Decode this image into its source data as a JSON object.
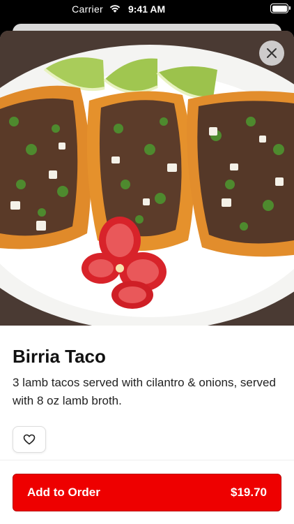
{
  "status_bar": {
    "carrier": "Carrier",
    "time": "9:41 AM"
  },
  "item": {
    "name": "Birria Taco",
    "description": "3 lamb tacos served with cilantro & onions, served with 8 oz lamb broth.",
    "image": "birria-tacos-photo"
  },
  "actions": {
    "add_to_order_label": "Add to Order",
    "price": "$19.70"
  },
  "icons": {
    "close": "close-icon",
    "favorite": "heart-icon"
  },
  "colors": {
    "primary": "#ee0000",
    "text": "#111111"
  }
}
